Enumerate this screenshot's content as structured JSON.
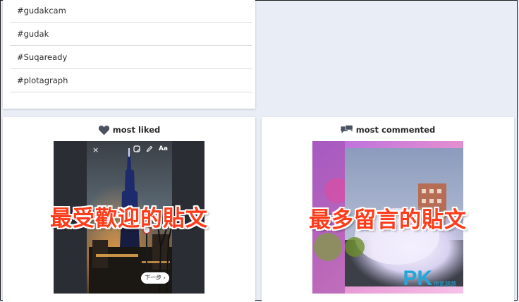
{
  "hashtags": {
    "items": [
      "#gudakcam",
      "#gudak",
      "#Suqaready",
      "#plotagraph"
    ]
  },
  "most_liked": {
    "title": "most liked",
    "overlay_text": "最受歡迎的貼文",
    "close_glyph": "×",
    "text_tool_label": "Aa",
    "next_button_label": "下一步 ›"
  },
  "most_commented": {
    "title": "most commented",
    "overlay_text": "最多留言的貼文"
  },
  "watermark": {
    "logo_text": "PK",
    "sub_text": "痞凱踏踏"
  },
  "colors": {
    "page_bg": "#e9edf5",
    "overlay_red": "#ff3b1a",
    "logo_blue": "#23a7d8",
    "icon_gray": "#4a5261"
  }
}
